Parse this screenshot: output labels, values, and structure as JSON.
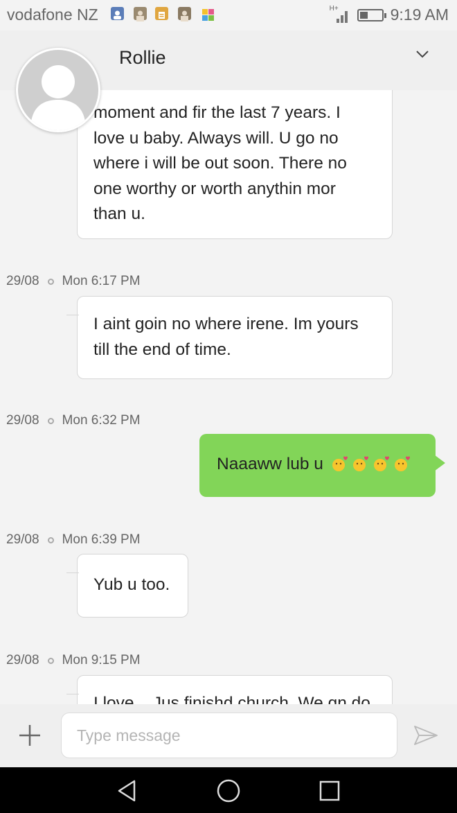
{
  "status_bar": {
    "carrier": "vodafone NZ",
    "network": "H+",
    "time": "9:19 AM",
    "battery_level": 0.35,
    "icons": [
      "contacts-icon",
      "photo-icon",
      "clipboard-icon",
      "photo-icon",
      "gallery-icon"
    ]
  },
  "header": {
    "contact_name": "Rollie"
  },
  "messages": [
    {
      "direction": "in",
      "lines": [
        "moment and fir the last 7 years. I",
        "love u baby. Always will. U go no",
        "where i will be out soon. There no",
        "one worthy or worth anythin mor",
        "than u."
      ]
    },
    {
      "date": "29/08",
      "time": "Mon 6:17 PM",
      "direction": "in",
      "lines": [
        "I aint goin no where irene. Im yours",
        "till the end of time."
      ]
    },
    {
      "date": "29/08",
      "time": "Mon 6:32 PM",
      "direction": "out",
      "lines": [
        "Naaaww lub u"
      ],
      "emoji": [
        "kissing-emoji",
        "kissing-emoji",
        "kissing-emoji",
        "kissing-emoji"
      ]
    },
    {
      "date": "29/08",
      "time": "Mon 6:39 PM",
      "direction": "in",
      "lines": [
        "Yub u too."
      ]
    },
    {
      "date": "29/08",
      "time": "Mon 9:15 PM",
      "direction": "in",
      "lines": [
        "I love ...Jus finishd church. We gn do"
      ]
    }
  ],
  "composer": {
    "placeholder": "Type message",
    "value": ""
  },
  "colors": {
    "outgoing_bubble": "#82d558",
    "incoming_bubble": "#ffffff",
    "background": "#f3f3f3"
  }
}
